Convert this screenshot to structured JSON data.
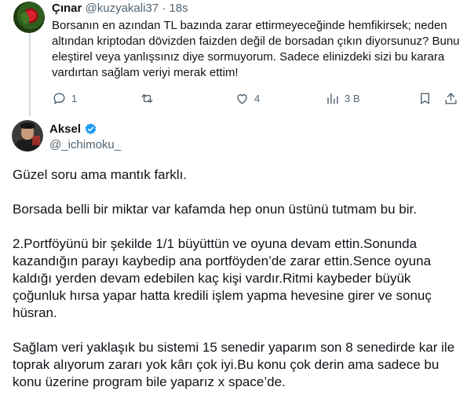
{
  "parent_tweet": {
    "author_name": "Çınar",
    "author_handle": "@kuzyakali37",
    "separator": "·",
    "time": "18s",
    "text": "Borsanın en azından TL bazında zarar ettirmeyeceğinde hemfikirsek; neden altından kriptodan dövizden faizden değil de borsadan çıkın diyorsunuz? Bunu eleştirel veya yanlışsınız diye sormuyorum. Sadece elinizdeki sizi bu karara vardırtan sağlam veriyi merak ettim!",
    "actions": {
      "reply_count": "1",
      "retweet_count": "",
      "like_count": "4",
      "views_count": "3 B"
    }
  },
  "main_tweet": {
    "author_name": "Aksel",
    "author_handle": "@_ichimoku_",
    "verified": true,
    "paragraphs": [
      "Güzel soru ama mantık farklı.",
      "Borsada belli bir miktar var kafamda hep onun üstünü tutmam bu bir.",
      "2.Portföyünü bir şekilde 1/1 büyüttün ve oyuna devam ettin.Sonunda kazandığın parayı kaybedip ana portföyden’de zarar ettin.Sence oyuna kaldığı yerden devam edebilen kaç kişi vardır.Ritmi kaybeder büyük çoğunluk hırsa yapar hatta kredili işlem yapma hevesine girer ve sonuç hüsran.",
      "Sağlam veri yaklaşık bu sistemi 15 senedir yaparım son 8 senedirde kar ile toprak alıyorum zararı yok kârı çok iyi.Bu konu çok derin ama sadece bu konu üzerine program bile yaparız x space’de."
    ]
  },
  "colors": {
    "text_primary": "#0f1419",
    "text_secondary": "#536471",
    "verified_blue": "#1d9bf0",
    "thread_line": "#cfd9de"
  },
  "icons": [
    "reply-icon",
    "retweet-icon",
    "like-icon",
    "views-icon",
    "bookmark-icon",
    "share-icon",
    "verified-badge-icon"
  ]
}
